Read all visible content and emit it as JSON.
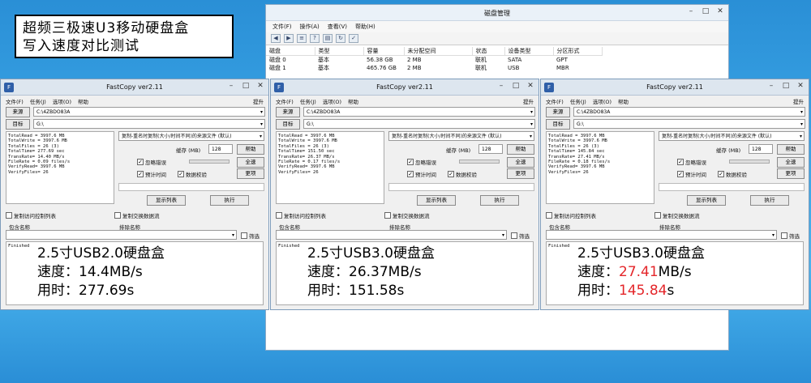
{
  "banner": {
    "line1": "超频三极速U3移动硬盘盒",
    "line2": "写入速度对比测试"
  },
  "dm": {
    "title": "磁盘管理",
    "menu": [
      "文件(F)",
      "操作(A)",
      "查看(V)",
      "帮助(H)"
    ],
    "columns": [
      "磁盘",
      "类型",
      "未分配空间",
      "状态",
      "设备类型",
      "分区形式"
    ],
    "capacity_header": "容量",
    "rows": [
      [
        "磁盘 0",
        "基本",
        "56.38 GB",
        "2 MB",
        "联机",
        "SATA",
        "GPT"
      ],
      [
        "磁盘 1",
        "基本",
        "465.76 GB",
        "2 MB",
        "联机",
        "USB",
        "MBR"
      ]
    ]
  },
  "fc": {
    "title": "FastCopy ver2.11",
    "menu": [
      "文件(F)",
      "任务(J)",
      "选项(O)",
      "帮助"
    ],
    "tip": "提升",
    "source_label": "来源",
    "source": "C:\\4ZBDO83A",
    "dest_label": "目标",
    "dest": "G:\\",
    "mode": "复制-重名时复制(大小/时间不同)的来源文件 (默认)",
    "buffer_label": "缓存 (MB)",
    "buffer": "128",
    "help": "帮助",
    "ignore_err": "忽略错误",
    "est_time": "预计时间",
    "verify": "数据校验",
    "full_speed": "全速",
    "options": "更项",
    "list": "显示列表",
    "run": "执行",
    "acl": "复制访问控制列表",
    "alt": "复制交换数据流",
    "include": "包含名称",
    "exclude": "排除名称",
    "filter": "筛选",
    "finished": "Finished"
  },
  "panels": [
    {
      "stats": [
        "TotalRead = 3997.6 MB",
        "TotalWrite = 3997.6 MB",
        "TotalFiles = 26 (3)",
        "TotalTime= 277.69 sec",
        "TransRate= 14.40 MB/s",
        "FileRate = 0.09 files/s",
        "VerifyRead= 3997.6 MB",
        "VerifyFiles= 26"
      ],
      "ov1": "2.5寸USB2.0硬盘盒",
      "ov2_label": "速度：",
      "ov2_value": "14.4MB/s",
      "ov3_label": "用时：",
      "ov3_value": "277.69s",
      "highlight": false
    },
    {
      "stats": [
        "TotalRead = 3997.6 MB",
        "TotalWrite = 3997.6 MB",
        "TotalFiles = 26 (3)",
        "TotalTime= 151.50 sec",
        "TransRate= 26.37 MB/s",
        "FileRate = 0.17 files/s",
        "VerifyRead= 3997.6 MB",
        "VerifyFiles= 26"
      ],
      "ov1": "2.5寸USB3.0硬盘盒",
      "ov2_label": "速度：",
      "ov2_value": "26.37MB/s",
      "ov3_label": "用时：",
      "ov3_value": "151.58s",
      "highlight": false
    },
    {
      "stats": [
        "TotalRead = 3997.6 MB",
        "TotalWrite = 3997.6 MB",
        "TotalFiles = 26 (3)",
        "TotalTime= 145.84 sec",
        "TransRate= 27.41 MB/s",
        "FileRate = 0.18 files/s",
        "VerifyRead= 3997.6 MB",
        "VerifyFiles= 26"
      ],
      "ov1": "2.5寸USB3.0硬盘盒",
      "ov2_label": "速度：",
      "ov2_value": "27.41",
      "ov2_suffix": "MB/s",
      "ov3_label": "用时：",
      "ov3_value": "145.84",
      "ov3_suffix": "s",
      "highlight": true
    }
  ],
  "colors": {
    "highlight": "#e4262a",
    "desktop": "#3aa5e6"
  }
}
